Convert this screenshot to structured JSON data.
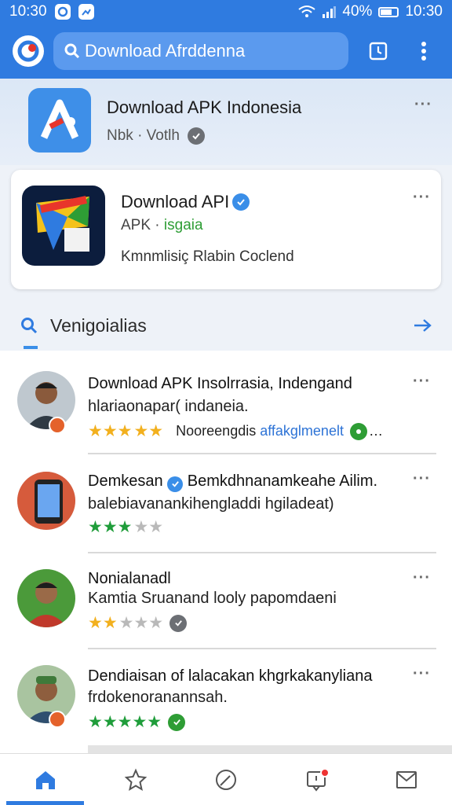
{
  "status_bar": {
    "time_left": "10:30",
    "battery": "40%",
    "time_right": "10:30"
  },
  "search": {
    "text": "Download Afrddenna"
  },
  "hero": {
    "title": "Download APK Indonesia",
    "subtitle": "Nbk · Votlh"
  },
  "featured": {
    "title": "Download API",
    "meta_prefix": "APK · ",
    "meta_highlight": "isgaia",
    "description": "Kmnmlisiç Rlabin Coclend"
  },
  "section": {
    "title": "Venigoialias"
  },
  "reviews": [
    {
      "title_bold": "Download APK Insolrrasia,",
      "title_rest": " Indengand",
      "line2": "hlariaonapar( indaneia.",
      "stars": "★★★★★",
      "note_prefix": "Nooreengdis ",
      "note_highlight": "affakglmenelt",
      "note_suffix": " …"
    },
    {
      "title_bold": "Demkesan",
      "title_rest": " Bemkdhnanamkeahe Ailim.",
      "line2": "balebiavanankihengladdi hgiladeat)",
      "stars": "★★★★★"
    },
    {
      "title_bold": "Nonialanadl",
      "line2": "Kamtia Sruanand looly papomdaeni",
      "stars": "★★★★★"
    },
    {
      "title_bold": "Dendiaisan of lalacakan khgrkakanyliana",
      "line2": "frdokenoranannsah.",
      "stars": "★★★★★"
    }
  ],
  "colors": {
    "primary": "#2f7be0",
    "star_gold": "#f2b01e",
    "star_green": "#1f9d3a",
    "star_empty": "#b9b9b9"
  }
}
